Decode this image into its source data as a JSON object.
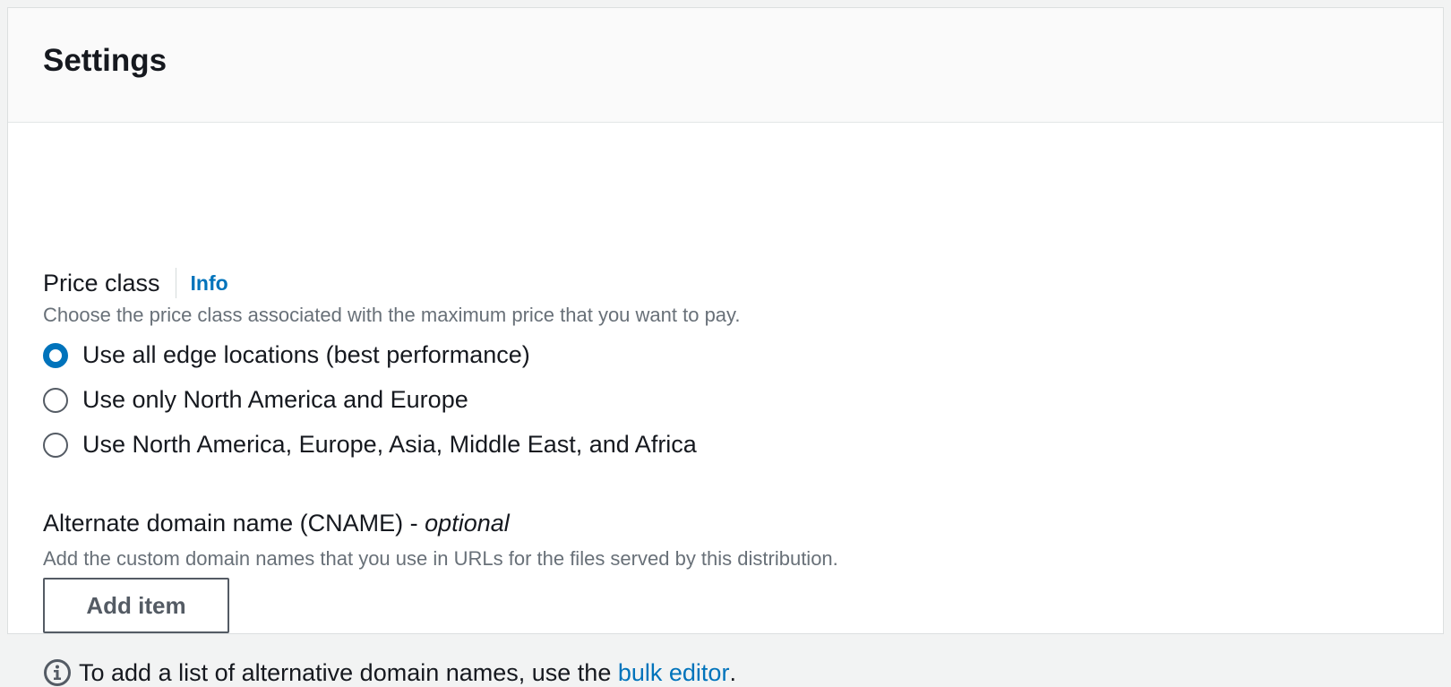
{
  "settings": {
    "title": "Settings"
  },
  "price_class": {
    "label": "Price class",
    "info_link": "Info",
    "description": "Choose the price class associated with the maximum price that you want to pay.",
    "options": [
      {
        "label": "Use all edge locations (best performance)",
        "selected": true
      },
      {
        "label": "Use only North America and Europe",
        "selected": false
      },
      {
        "label": "Use North America, Europe, Asia, Middle East, and Africa",
        "selected": false
      }
    ]
  },
  "cname": {
    "label": "Alternate domain name (CNAME) - ",
    "optional": "optional",
    "description": "Add the custom domain names that you use in URLs for the files served by this distribution.",
    "add_button": "Add item",
    "note_prefix": "To add a list of alternative domain names, use the ",
    "note_link": "bulk editor",
    "note_suffix": "."
  },
  "colors": {
    "accent": "#0073bb",
    "text": "#16191f",
    "muted": "#687078"
  }
}
